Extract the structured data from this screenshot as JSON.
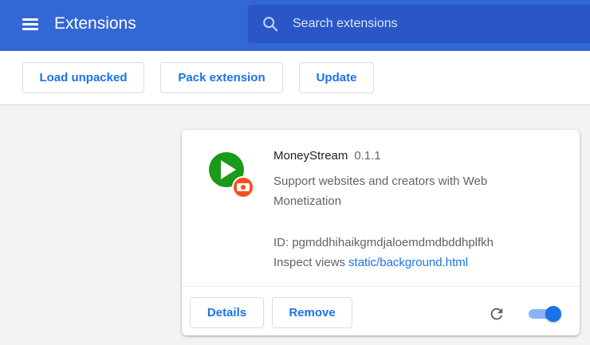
{
  "header": {
    "title": "Extensions",
    "menu_icon": "hamburger-menu-icon",
    "search": {
      "placeholder": "Search extensions",
      "value": "",
      "icon": "search-icon"
    },
    "color": "#3367d6"
  },
  "toolbar": {
    "load_unpacked": "Load unpacked",
    "pack_extension": "Pack extension",
    "update": "Update"
  },
  "extension": {
    "name": "MoneyStream",
    "version": "0.1.1",
    "description": "Support websites and creators with Web Monetization",
    "id_label": "ID:",
    "id": "pgmddhihaikgmdjaloemdmdbddhplfkh",
    "inspect_label": "Inspect views",
    "inspect_link": "static/background.html",
    "enabled": true,
    "icon": "play-icon",
    "badge_icon": "record-badge-icon",
    "details_label": "Details",
    "remove_label": "Remove",
    "reload_icon": "reload-icon"
  },
  "colors": {
    "accent": "#1a73e8",
    "icon_green": "#1a9a1a",
    "badge_orange": "#f4511e"
  }
}
